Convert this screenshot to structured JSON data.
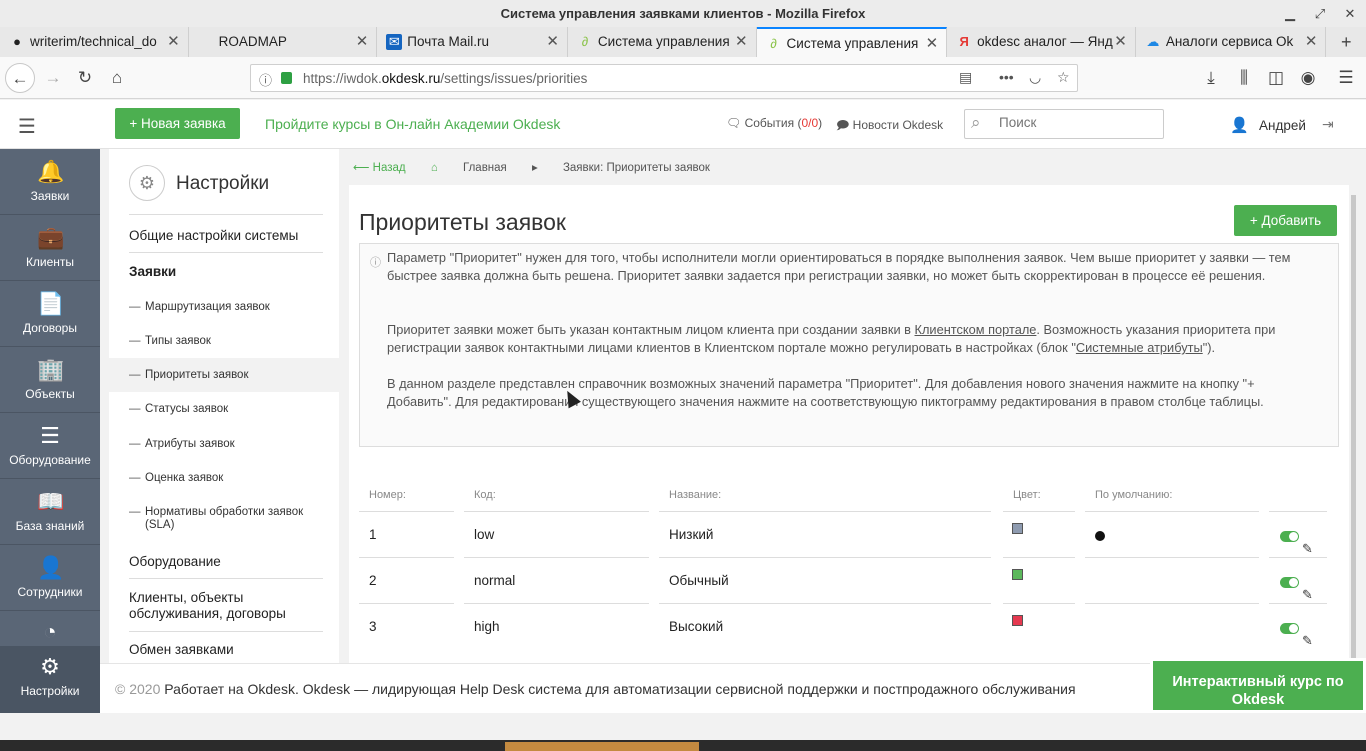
{
  "window": {
    "title": "Система управления заявками клиентов - Mozilla Firefox"
  },
  "tabs": [
    {
      "label": "writerim/technical_do",
      "icon": "github-icon"
    },
    {
      "label": "ROADMAP",
      "icon": ""
    },
    {
      "label": "Почта Mail.ru",
      "icon": "mail-icon"
    },
    {
      "label": "Система управления",
      "icon": "okdesk-icon"
    },
    {
      "label": "Система управления",
      "icon": "okdesk-icon",
      "active": true
    },
    {
      "label": "okdesc аналог — Янд",
      "icon": "yandex-icon"
    },
    {
      "label": "Аналоги сервиса Ok",
      "icon": "cloud-icon"
    }
  ],
  "url": {
    "prefix": "https://iwdok.",
    "host": "okdesk.ru",
    "path": "/settings/issues/priorities"
  },
  "header": {
    "new_issue": "+ Новая заявка",
    "promo": "Пройдите курсы в Он-лайн Академии Okdesk",
    "events_label": "События (",
    "events_count": "0/0",
    "events_end": ")",
    "news": "Новости Okdesk",
    "search_placeholder": "Поиск",
    "user": "Андрей"
  },
  "leftnav": [
    {
      "label": "Заявки",
      "icon": "bell-icon"
    },
    {
      "label": "Клиенты",
      "icon": "briefcase-icon"
    },
    {
      "label": "Договоры",
      "icon": "documents-icon"
    },
    {
      "label": "Объекты",
      "icon": "building-icon"
    },
    {
      "label": "Оборудование",
      "icon": "server-icon"
    },
    {
      "label": "База знаний",
      "icon": "book-icon"
    },
    {
      "label": "Сотрудники",
      "icon": "user-icon"
    },
    {
      "label": "Настройки",
      "icon": "gear-icon"
    }
  ],
  "settings_nav": {
    "title": "Настройки",
    "general": "Общие настройки системы",
    "issues": "Заявки",
    "sub": [
      "Маршрутизация заявок",
      "Типы заявок",
      "Приоритеты заявок",
      "Статусы заявок",
      "Атрибуты заявок",
      "Оценка заявок",
      "Нормативы обработки заявок (SLA)"
    ],
    "equipment": "Оборудование",
    "clients": "Клиенты, объекты обслуживания, договоры",
    "exchange": "Обмен заявками"
  },
  "breadcrumbs": {
    "back": "⟵ Назад",
    "home": "Главная",
    "current": "Заявки: Приоритеты заявок"
  },
  "page": {
    "title": "Приоритеты заявок",
    "add": "+ Добавить",
    "info1": "Параметр \"Приоритет\" нужен для того, чтобы исполнители могли ориентироваться в порядке выполнения заявок. Чем выше приоритет у заявки — тем быстрее заявка должна быть решена. Приоритет заявки задается при регистрации заявки, но может быть скорректирован в процессе её решения.",
    "info2a": "Приоритет заявки может быть указан контактным лицом клиента при создании заявки в ",
    "info2link": "Клиентском портале",
    "info2b": ". Возможность указания приоритета при регистрации заявок контактными лицами клиентов в Клиентском портале можно регулировать в настройках (блок \"",
    "info2link2": "Системные атрибуты",
    "info2c": "\").",
    "info3": "В данном разделе представлен справочник возможных значений параметра \"Приоритет\". Для добавления нового значения нажмите на кнопку \"+ Добавить\". Для редактирования существующего значения нажмите на соответствующую пиктограмму редактирования в правом столбце таблицы."
  },
  "table": {
    "headers": [
      "Номер:",
      "Код:",
      "Название:",
      "Цвет:",
      "По умолчанию:"
    ],
    "rows": [
      {
        "num": "1",
        "code": "low",
        "name": "Низкий",
        "color": "#8e9bb0",
        "default": true
      },
      {
        "num": "2",
        "code": "normal",
        "name": "Обычный",
        "color": "#5cb85c",
        "default": false
      },
      {
        "num": "3",
        "code": "high",
        "name": "Высокий",
        "color": "#e53950",
        "default": false
      }
    ]
  },
  "footer": {
    "copy": "© 2020",
    "text": "Работает на Okdesk. Okdesk — лидирующая Help Desk система для автоматизации сервисной поддержки и постпродажного обслуживания"
  },
  "course": "Интерактивный курс по Okdesk"
}
